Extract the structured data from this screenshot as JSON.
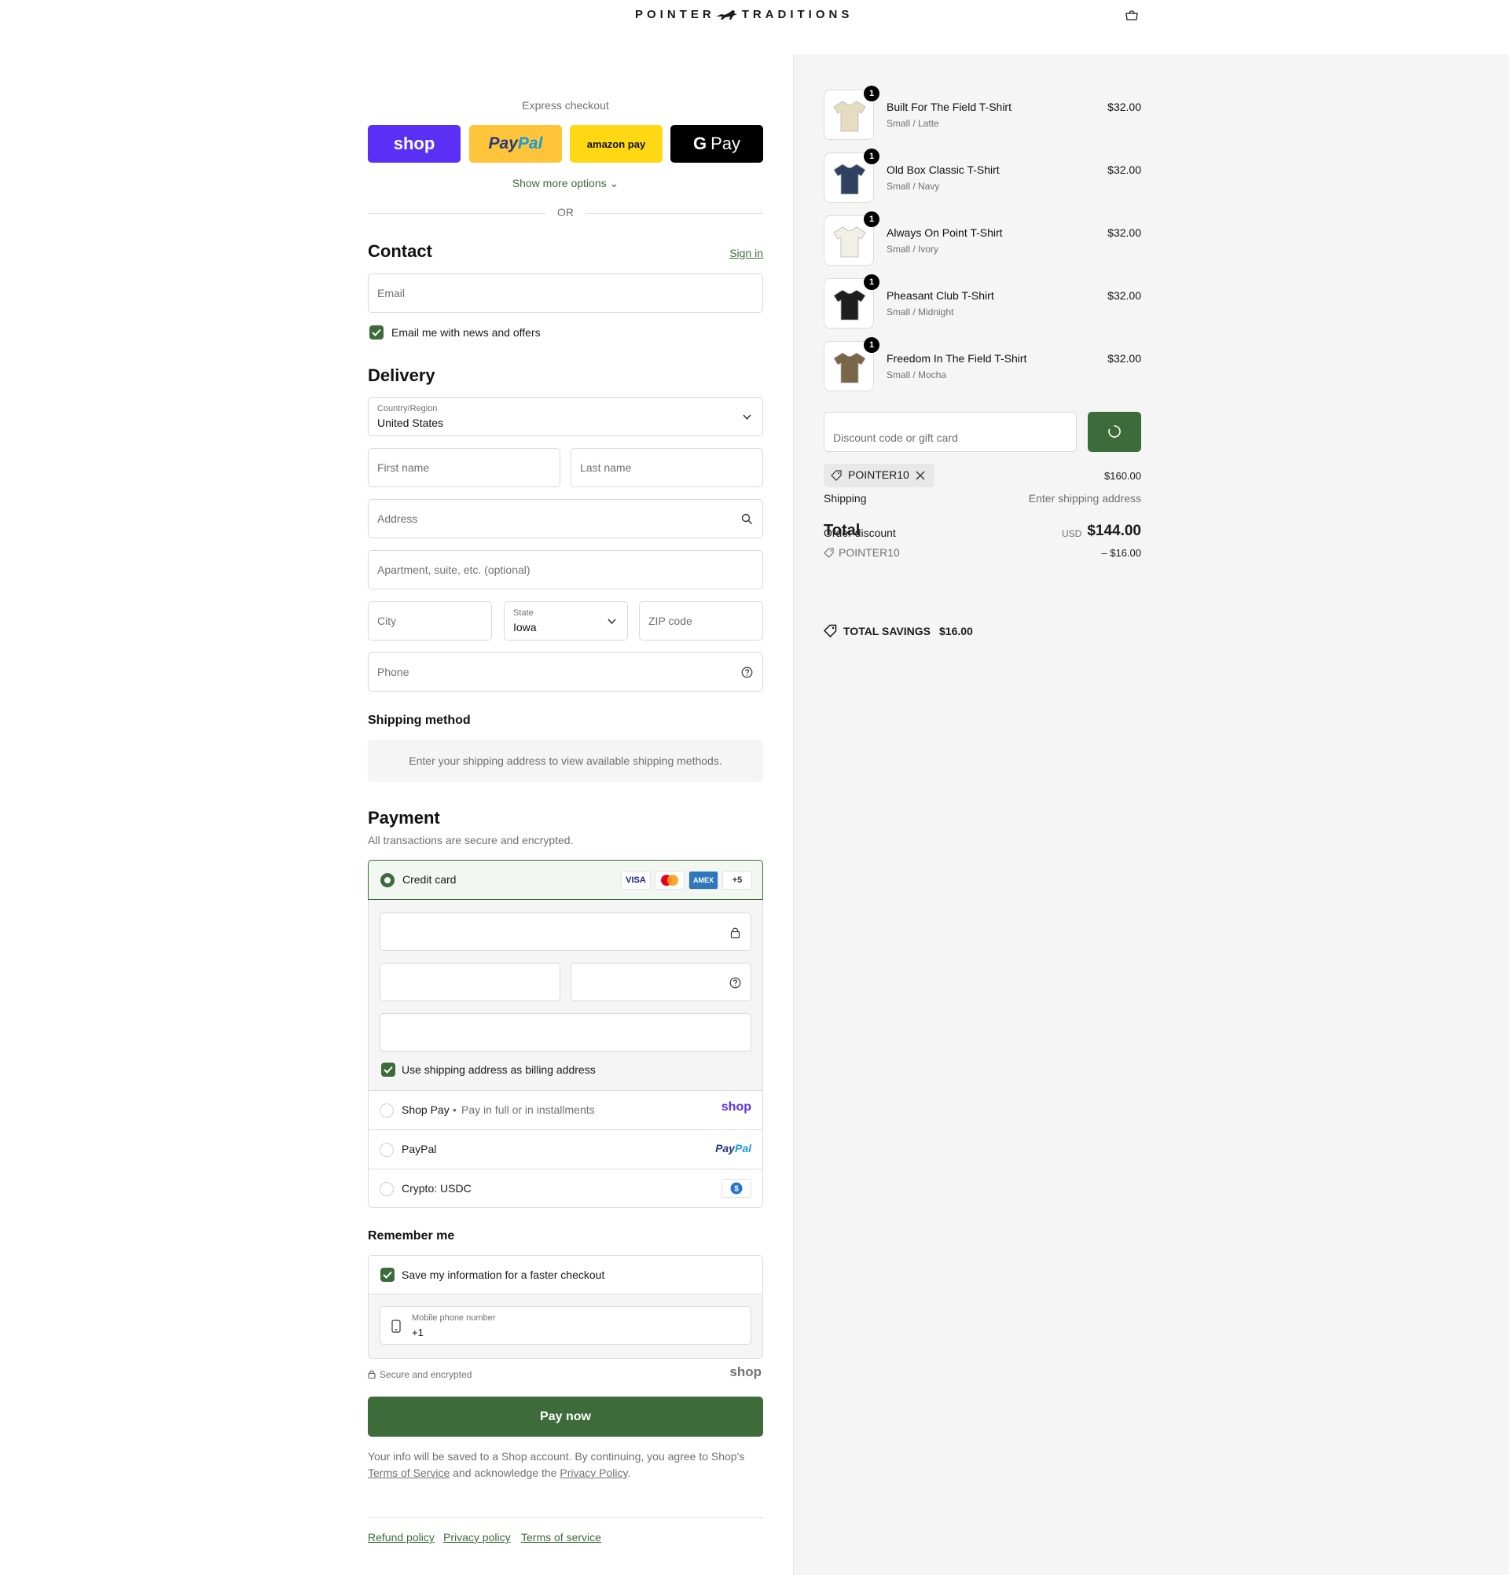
{
  "header": {
    "brand_left": "POINTER",
    "brand_right": "TRADITIONS"
  },
  "express": {
    "title": "Express checkout",
    "shop_label": "shop",
    "paypal_label_pay": "Pay",
    "paypal_label_pal": "Pal",
    "amazon_label": "amazon pay",
    "gpay_label": "Pay",
    "show_more": "Show more options",
    "or": "OR"
  },
  "contact": {
    "title": "Contact",
    "sign_in": "Sign in",
    "email_placeholder": "Email",
    "newsletter_label": "Email me with news and offers"
  },
  "delivery": {
    "title": "Delivery",
    "country_label": "Country/Region",
    "country_value": "United States",
    "first_name": "First name",
    "last_name": "Last name",
    "address": "Address",
    "apartment": "Apartment, suite, etc. (optional)",
    "city": "City",
    "state_label": "State",
    "state_value": "Iowa",
    "zip": "ZIP code",
    "phone": "Phone"
  },
  "shipping_method": {
    "title": "Shipping method",
    "notice": "Enter your shipping address to view available shipping methods."
  },
  "payment": {
    "title": "Payment",
    "subtitle": "All transactions are secure and encrypted.",
    "credit_card": "Credit card",
    "visa": "VISA",
    "amex": "AMEX",
    "more_cards": "+5",
    "billing_same": "Use shipping address as billing address",
    "shop_pay": "Shop Pay",
    "shop_pay_sub": "Pay in full or in installments",
    "shop_pay_logo": "shop",
    "paypal": "PayPal",
    "paypal_logo_pay": "Pay",
    "paypal_logo_pal": "Pal",
    "crypto": "Crypto: USDC"
  },
  "remember": {
    "title": "Remember me",
    "save_label": "Save my information for a faster checkout",
    "mobile_label": "Mobile phone number",
    "mobile_value": "+1",
    "secure": "Secure and encrypted",
    "shop_logo": "shop"
  },
  "pay_button": "Pay now",
  "legal": {
    "line1": "Your info will be saved to a Shop account. By continuing, you agree to Shop's",
    "terms": "Terms of Service",
    "and_ack": "and acknowledge the",
    "privacy": "Privacy Policy",
    "period": "."
  },
  "footer": {
    "refund": "Refund policy",
    "privacy": "Privacy policy",
    "terms": "Terms of service"
  },
  "cart": {
    "items": [
      {
        "name": "Built For The Field T-Shirt",
        "variant": "Small / Latte",
        "price": "$32.00",
        "qty": "1",
        "color": "#e6dcc0"
      },
      {
        "name": "Old Box Classic T-Shirt",
        "variant": "Small / Navy",
        "price": "$32.00",
        "qty": "1",
        "color": "#2f4160"
      },
      {
        "name": "Always On Point T-Shirt",
        "variant": "Small / Ivory",
        "price": "$32.00",
        "qty": "1",
        "color": "#f2efe4"
      },
      {
        "name": "Pheasant Club T-Shirt",
        "variant": "Small / Midnight",
        "price": "$32.00",
        "qty": "1",
        "color": "#1f1f1f"
      },
      {
        "name": "Freedom In The Field T-Shirt",
        "variant": "Small / Mocha",
        "price": "$32.00",
        "qty": "1",
        "color": "#7a6648"
      }
    ],
    "discount_placeholder": "Discount code or gift card",
    "applied_code": "POINTER10",
    "subtotal": "$160.00",
    "shipping_label": "Shipping",
    "shipping_value": "Enter shipping address",
    "total_label": "Total",
    "order_discount": "Order discount",
    "currency": "USD",
    "total": "$144.00",
    "discount_code": "POINTER10",
    "discount_amount": "– $16.00",
    "savings_label": "TOTAL SAVINGS",
    "savings_value": "$16.00"
  },
  "colors": {
    "accent": "#3d6b3a",
    "shop_purple": "#5a31f4",
    "paypal_yellow": "#ffc439",
    "amazon_yellow": "#ffd814"
  }
}
